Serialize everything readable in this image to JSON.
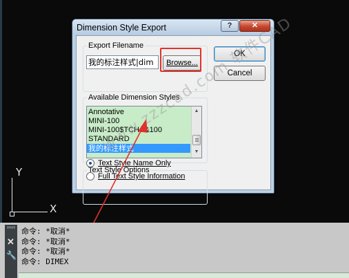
{
  "dialog": {
    "title": "Dimension Style Export",
    "help_button": "?",
    "close_button": "✕",
    "export_filename": {
      "group_label": "Export Filename",
      "value": "我的标注样式|dim",
      "browse_label": "Browse..."
    },
    "available_styles": {
      "group_label": "Available Dimension Styles",
      "items": [
        {
          "label": "Annotative",
          "selected": false
        },
        {
          "label": "MINI-100",
          "selected": false
        },
        {
          "label": "MINI-100$TCH&&100",
          "selected": false
        },
        {
          "label": "STANDARD",
          "selected": false
        },
        {
          "label": "我的标注样式",
          "selected": true
        }
      ]
    },
    "text_style_options": {
      "group_label": "Text Style Options",
      "radio_name_only": "Text Style Name Only",
      "radio_full_info": "Full Text Style Information",
      "selected": "name_only"
    },
    "ok_label": "OK",
    "cancel_label": "Cancel"
  },
  "viewport": {
    "axis_y_label": "Y",
    "axis_x_label": "X"
  },
  "watermark": "www.zzzcad.com 软件CAD",
  "command_history": [
    "命令: *取消*",
    "命令: *取消*",
    "命令: *取消*",
    "命令: DIMEX"
  ],
  "command_panel": {
    "close_icon": "✕",
    "wrench_icon": "🔧"
  },
  "colors": {
    "highlight_red": "#e0312b",
    "list_background": "#c8ebc8",
    "selection_blue": "#3399ff"
  }
}
